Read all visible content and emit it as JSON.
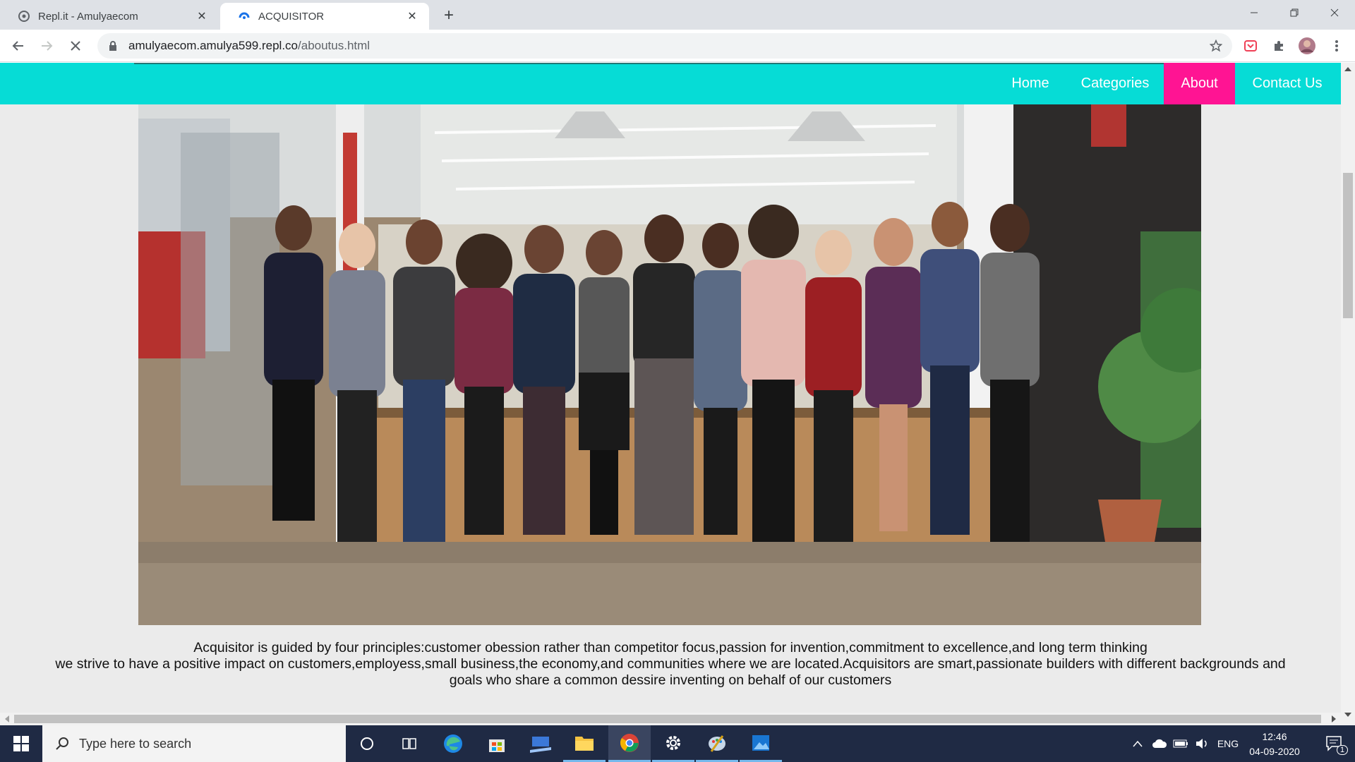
{
  "browser": {
    "tabs": [
      {
        "title": "Repl.it - Amulyaecom",
        "active": false
      },
      {
        "title": "ACQUISITOR",
        "active": true
      }
    ],
    "url_host": "amulyaecom.amulya599.repl.co",
    "url_path": "/aboutus.html"
  },
  "nav": {
    "home": "Home",
    "categories": "Categories",
    "about": "About",
    "contact": "Contact Us",
    "bar_color": "#06dcd6",
    "active_color": "#ff1493"
  },
  "about": {
    "line1": "Acquisitor is guided by four principles:customer obession rather than competitor focus,passion for invention,commitment to excellence,and long term thinking",
    "line2": "we strive to have a positive impact on customers,employess,small business,the economy,and communities where we are located.Acquisitors are smart,passionate builders with different backgrounds and goals who share a common dessire inventing on behalf of our customers"
  },
  "taskbar": {
    "search_placeholder": "Type here to search",
    "language": "ENG",
    "time": "12:46",
    "date": "04-09-2020",
    "notification_count": "1"
  }
}
